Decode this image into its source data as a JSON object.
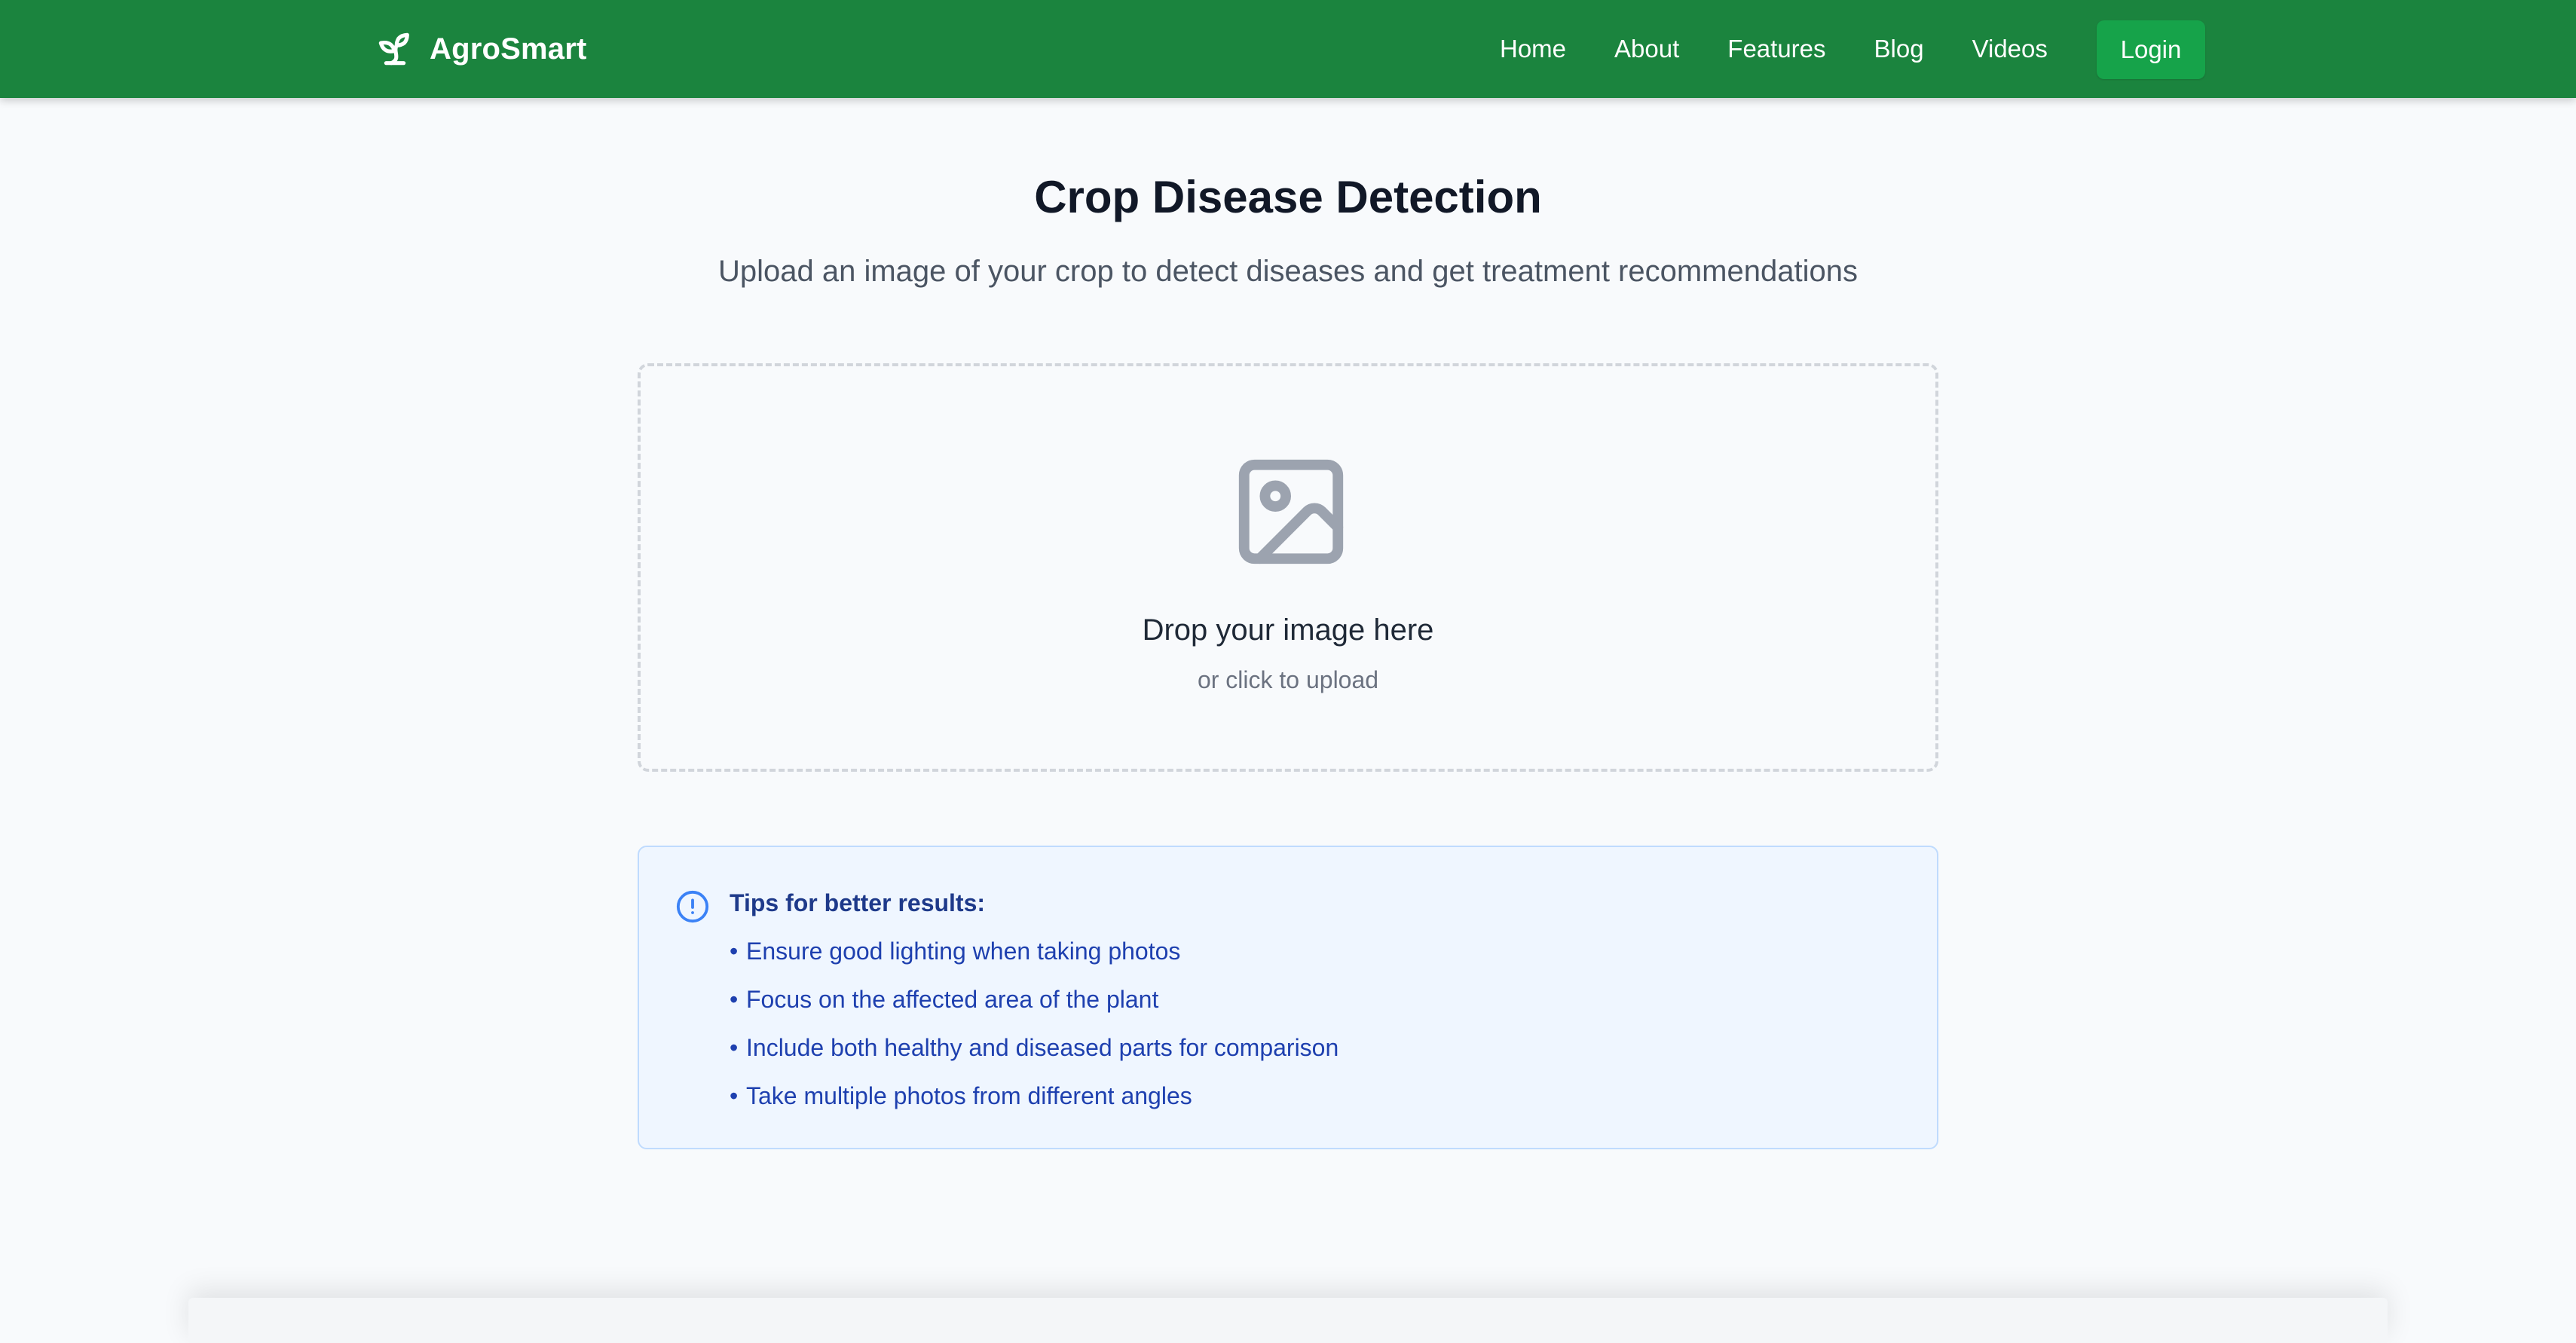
{
  "brand": {
    "name": "AgroSmart",
    "icon": "sprout-icon"
  },
  "nav": {
    "items": [
      {
        "label": "Home"
      },
      {
        "label": "About"
      },
      {
        "label": "Features"
      },
      {
        "label": "Blog"
      },
      {
        "label": "Videos"
      }
    ],
    "login_label": "Login"
  },
  "header": {
    "title": "Crop Disease Detection",
    "subtitle": "Upload an image of your crop to detect diseases and get treatment recommendations"
  },
  "upload": {
    "icon": "image-icon",
    "title": "Drop your image here",
    "subtitle": "or click to upload"
  },
  "tips": {
    "icon": "info-icon",
    "title": "Tips for better results:",
    "bullet": "•",
    "items": [
      "Ensure good lighting when taking photos",
      "Focus on the affected area of the plant",
      "Include both healthy and diseased parts for comparison",
      "Take multiple photos from different angles"
    ]
  },
  "colors": {
    "nav_background": "#1b843e",
    "login_button": "#16a34a",
    "tips_background": "#eff6ff",
    "tips_border": "#bfdbfe",
    "tips_text": "#1e40af"
  }
}
